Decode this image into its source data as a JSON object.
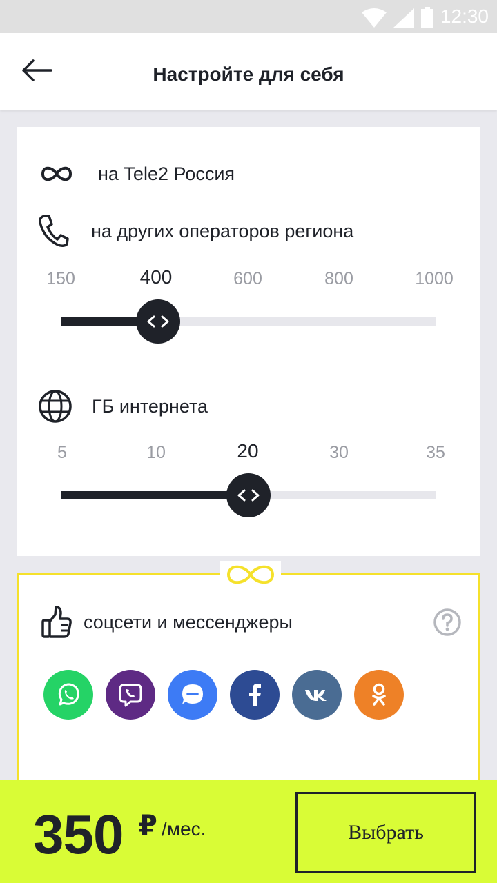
{
  "status_bar": {
    "time": "12:30"
  },
  "header": {
    "title": "Настройте для себя"
  },
  "tariff": {
    "tele2_row": {
      "label": "на Tele2 Россия",
      "icon": "infinity-icon"
    },
    "minutes_row": {
      "label": "на других операторов региона",
      "icon": "phone-icon"
    },
    "minutes_slider": {
      "ticks": [
        "150",
        "400",
        "600",
        "800",
        "1000"
      ],
      "selected": "400",
      "selected_index": 1,
      "fill_fraction": 0.26
    },
    "internet_row": {
      "label": "ГБ интернета",
      "icon": "globe-icon"
    },
    "internet_slider": {
      "ticks": [
        "5",
        "10",
        "20",
        "30",
        "35"
      ],
      "selected": "20",
      "selected_index": 2,
      "fill_fraction": 0.5
    }
  },
  "social": {
    "label": "соцсети и мессенджеры",
    "apps": [
      {
        "name": "whatsapp",
        "icon": "whatsapp-icon",
        "color": "#25d366"
      },
      {
        "name": "viber",
        "icon": "viber-icon",
        "color": "#5e2a84"
      },
      {
        "name": "tamtam",
        "icon": "tamtam-icon",
        "color": "#3d7bf5"
      },
      {
        "name": "facebook",
        "icon": "facebook-icon",
        "color": "#2d4b93"
      },
      {
        "name": "vk",
        "icon": "vk-icon",
        "color": "#4a6c93"
      },
      {
        "name": "odnoklassniki",
        "icon": "odnoklassniki-icon",
        "color": "#ee8127"
      }
    ]
  },
  "bottom_bar": {
    "price": "350",
    "currency": "₽",
    "period": "/мес.",
    "button_label": "Выбрать"
  },
  "colors": {
    "accent": "#d9fc36",
    "border_yellow": "#f5e12b",
    "dark": "#1f2229"
  }
}
